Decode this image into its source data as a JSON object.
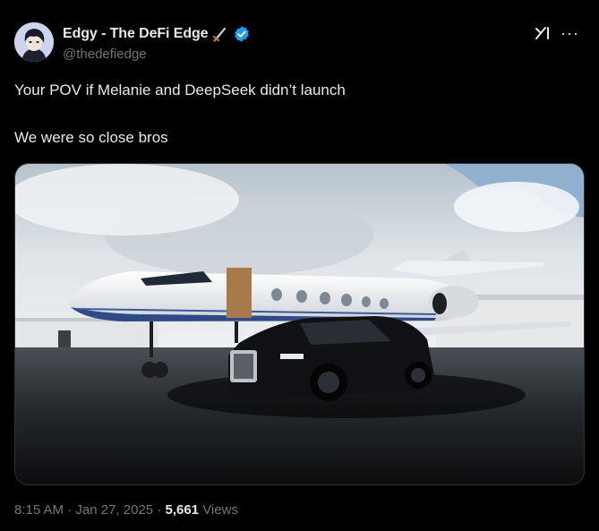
{
  "author": {
    "display_name": "Edgy - The DeFi Edge",
    "handle": "@thedefiedge",
    "verified": true,
    "avatar_icon": "anime-avatar-icon"
  },
  "tweet": {
    "line1": "Your POV if Melanie and DeepSeek didn’t launch",
    "line2": "We were so close bros"
  },
  "media": {
    "icon": "photo-private-jet-and-luxury-car"
  },
  "meta": {
    "time": "8:15 AM",
    "sep1": "·",
    "date": "Jan 27, 2025",
    "sep2": "·",
    "views_count": "5,661",
    "views_label": "Views"
  },
  "actions": {
    "grok_icon": "grok-icon",
    "more_icon": "more-icon",
    "more_glyph": "···"
  },
  "colors": {
    "background": "#000000",
    "text_primary": "#e7e9ea",
    "text_secondary": "#71767b",
    "verified": "#1d9bf0"
  }
}
